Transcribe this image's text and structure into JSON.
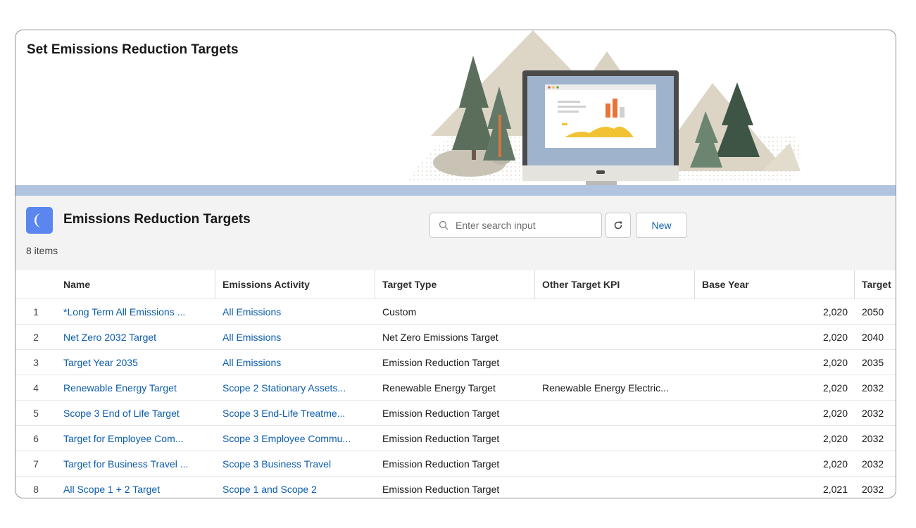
{
  "banner": {
    "title": "Set Emissions Reduction Targets"
  },
  "list": {
    "icon": "moon-icon",
    "title": "Emissions Reduction Targets",
    "count": "8 items",
    "search_placeholder": "Enter search input",
    "new_label": "New"
  },
  "colors": {
    "accent": "#5b86f0",
    "link": "#0b5cab",
    "band": "#b0c4df"
  },
  "table": {
    "columns": [
      "Name",
      "Emissions Activity",
      "Target Type",
      "Other Target KPI",
      "Base Year",
      "Target"
    ],
    "rows": [
      [
        "1",
        "*Long Term All Emissions ...",
        "All Emissions",
        "Custom",
        "",
        "2,020",
        "2050"
      ],
      [
        "2",
        "Net Zero 2032 Target",
        "All Emissions",
        "Net Zero Emissions Target",
        "",
        "2,020",
        "2040"
      ],
      [
        "3",
        "Target Year 2035",
        "All Emissions",
        "Emission Reduction Target",
        "",
        "2,020",
        "2035"
      ],
      [
        "4",
        "Renewable Energy Target",
        "Scope 2 Stationary Assets...",
        "Renewable Energy Target",
        "Renewable Energy Electric...",
        "2,020",
        "2032"
      ],
      [
        "5",
        "Scope 3 End of Life Target",
        "Scope 3 End-Life Treatme...",
        "Emission Reduction Target",
        "",
        "2,020",
        "2032"
      ],
      [
        "6",
        "Target for Employee Com...",
        "Scope 3 Employee Commu...",
        "Emission Reduction Target",
        "",
        "2,020",
        "2032"
      ],
      [
        "7",
        "Target for Business Travel ...",
        "Scope 3 Business Travel",
        "Emission Reduction Target",
        "",
        "2,020",
        "2032"
      ],
      [
        "8",
        "All Scope 1 + 2 Target",
        "Scope 1 and Scope 2",
        "Emission Reduction Target",
        "",
        "2,021",
        "2032"
      ]
    ]
  }
}
